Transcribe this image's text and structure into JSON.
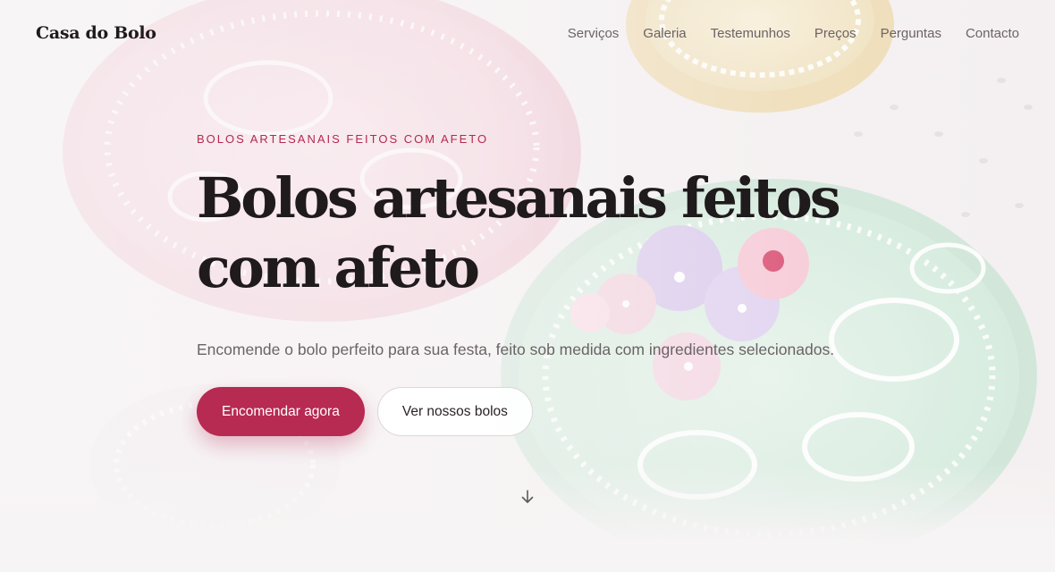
{
  "header": {
    "logo": "Casa do Bolo",
    "nav": [
      {
        "label": "Serviços"
      },
      {
        "label": "Galeria"
      },
      {
        "label": "Testemunhos"
      },
      {
        "label": "Preços"
      },
      {
        "label": "Perguntas"
      },
      {
        "label": "Contacto"
      }
    ]
  },
  "hero": {
    "eyebrow": "BOLOS ARTESANAIS FEITOS COM AFETO",
    "title_line1": "Bolos artesanais feitos",
    "title_line2": "com afeto",
    "subtitle": "Encomende o bolo perfeito para sua festa, feito sob medida com ingredientes selecionados.",
    "primary_cta": "Encomendar agora",
    "secondary_cta": "Ver nossos bolos",
    "background_icon": "decorated-cookies-photo",
    "scroll_icon": "arrow-down-icon"
  },
  "colors": {
    "accent": "#b72a52",
    "text_dark": "#1f1a1c",
    "text_muted": "#6b6366",
    "background": "#f7f4f5"
  }
}
